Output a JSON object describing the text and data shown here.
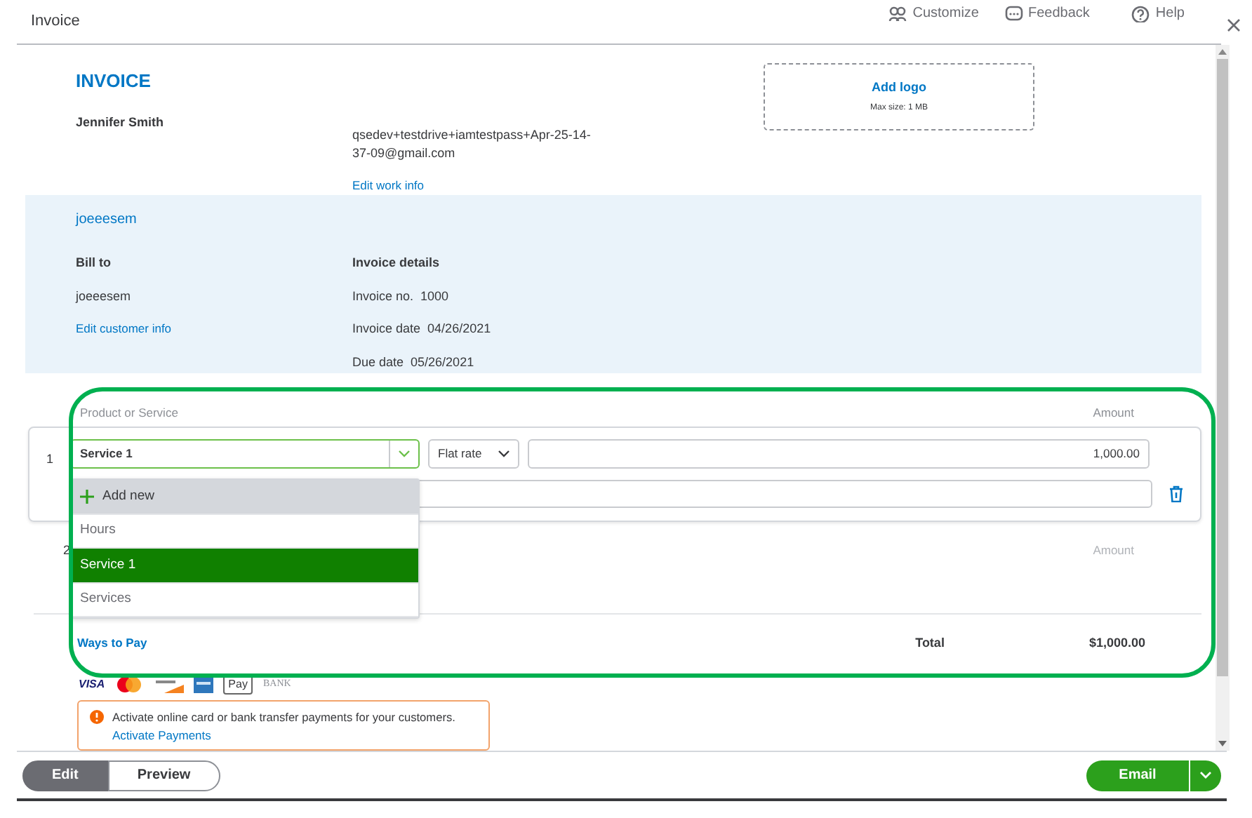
{
  "window": {
    "title": "Invoice",
    "actions": [
      {
        "kind": "customize",
        "label": "Customize"
      },
      {
        "kind": "feedback",
        "label": "Feedback"
      },
      {
        "kind": "help",
        "label": "Help"
      }
    ]
  },
  "header": {
    "title": "INVOICE",
    "name": "Jennifer Smith",
    "email": "qsedev+testdrive+iamtestpass+Apr-25-14-37-09@gmail.com",
    "edit_link": "Edit work info",
    "logo": {
      "label": "Add logo",
      "hint": "Max size: 1 MB"
    }
  },
  "customer": {
    "name": "joeeesem",
    "bill_to_label": "Bill to",
    "bill_to": "joeeesem",
    "edit_link": "Edit customer info",
    "details_title": "Invoice details",
    "details": [
      {
        "label": "Invoice no.",
        "value": "1000"
      },
      {
        "label": "Invoice date",
        "value": "04/26/2021"
      },
      {
        "label": "Due date",
        "value": "05/26/2021"
      }
    ]
  },
  "lines": {
    "columns": [
      "Product or Service",
      "Amount"
    ],
    "rows": [
      {
        "number": "1",
        "product": "Service 1",
        "rate_type": "Flat rate",
        "amount": "1,000.00"
      },
      {
        "number": "2",
        "amount_label": "Amount"
      }
    ],
    "dropdown": [
      {
        "kind": "action",
        "label": "Add new",
        "selected": false
      },
      {
        "kind": "option",
        "label": "Hours",
        "selected": false
      },
      {
        "kind": "option",
        "label": "Service 1",
        "selected": true
      },
      {
        "kind": "option",
        "label": "Services",
        "selected": false
      }
    ]
  },
  "payment": {
    "title": "Ways to Pay",
    "methods": [
      {
        "kind": "visa",
        "label": "VISA"
      },
      {
        "kind": "mastercard"
      },
      {
        "kind": "discover"
      },
      {
        "kind": "amex"
      },
      {
        "kind": "applepay",
        "label": "Pay"
      },
      {
        "kind": "bank",
        "label": "BANK"
      }
    ],
    "notice": "Activate online card or bank transfer payments for your customers.",
    "notice_link": "Activate Payments"
  },
  "totals": {
    "label": "Total",
    "value": "$1,000.00"
  },
  "footer": {
    "modes": [
      {
        "label": "Edit",
        "selected": true
      },
      {
        "label": "Preview",
        "selected": false
      }
    ],
    "send": "Email"
  }
}
